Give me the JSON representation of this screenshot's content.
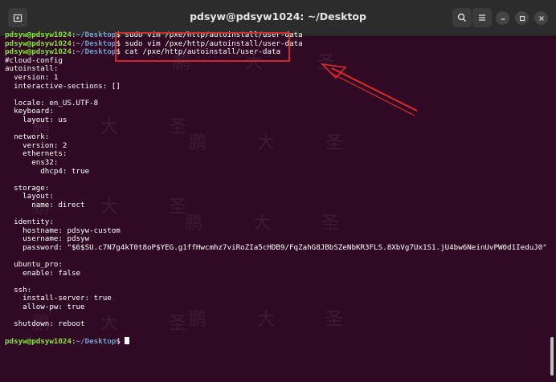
{
  "window": {
    "title": "pdsyw@pdsyw1024: ~/Desktop"
  },
  "colors": {
    "background": "#300a24",
    "user": "#8ae234",
    "path": "#729fcf",
    "highlight": "#e02a2a"
  },
  "icons": {
    "new_tab": "new-tab-icon",
    "search": "search-icon",
    "menu": "menu-icon",
    "minimize": "minimize-icon",
    "maximize": "maximize-icon",
    "close": "close-icon"
  },
  "prompt": {
    "user": "pdsyw@pdsyw1024",
    "sep": ":",
    "path": "~/Desktop",
    "dollar": "$ "
  },
  "commands": [
    "sudo vim /pxe/http/autoinstall/user-data",
    "sudo vim /pxe/http/autoinstall/user-data",
    "cat /pxe/http/autoinstall/user-data"
  ],
  "output": [
    "#cloud-config",
    "autoinstall:",
    "  version: 1",
    "  interactive-sections: []",
    "",
    "  locale: en_US.UTF-8",
    "  keyboard:",
    "    layout: us",
    "",
    "  network:",
    "    version: 2",
    "    ethernets:",
    "      ens32:",
    "        dhcp4: true",
    "",
    "  storage:",
    "    layout:",
    "      name: direct",
    "",
    "  identity:",
    "    hostname: pdsyw-custom",
    "    username: pdsyw",
    "    password: \"$6$SU.c7N7g4kT0t8oP$YEG.g1ffHwcmhz7viRoZIa5cHDB9/FqZahG8JBbSZeNbKR3FLS.8XbVg7Ux1S1.jU4bw6NeinUvPW0d1IeduJ0\"",
    "",
    "  ubuntu_pro:",
    "    enable: false",
    "",
    "  ssh:",
    "    install-server: true",
    "    allow-pw: true",
    "",
    "  shutdown: reboot",
    ""
  ],
  "watermark": {
    "char1": "鹏",
    "char2": "大",
    "char3": "圣"
  }
}
